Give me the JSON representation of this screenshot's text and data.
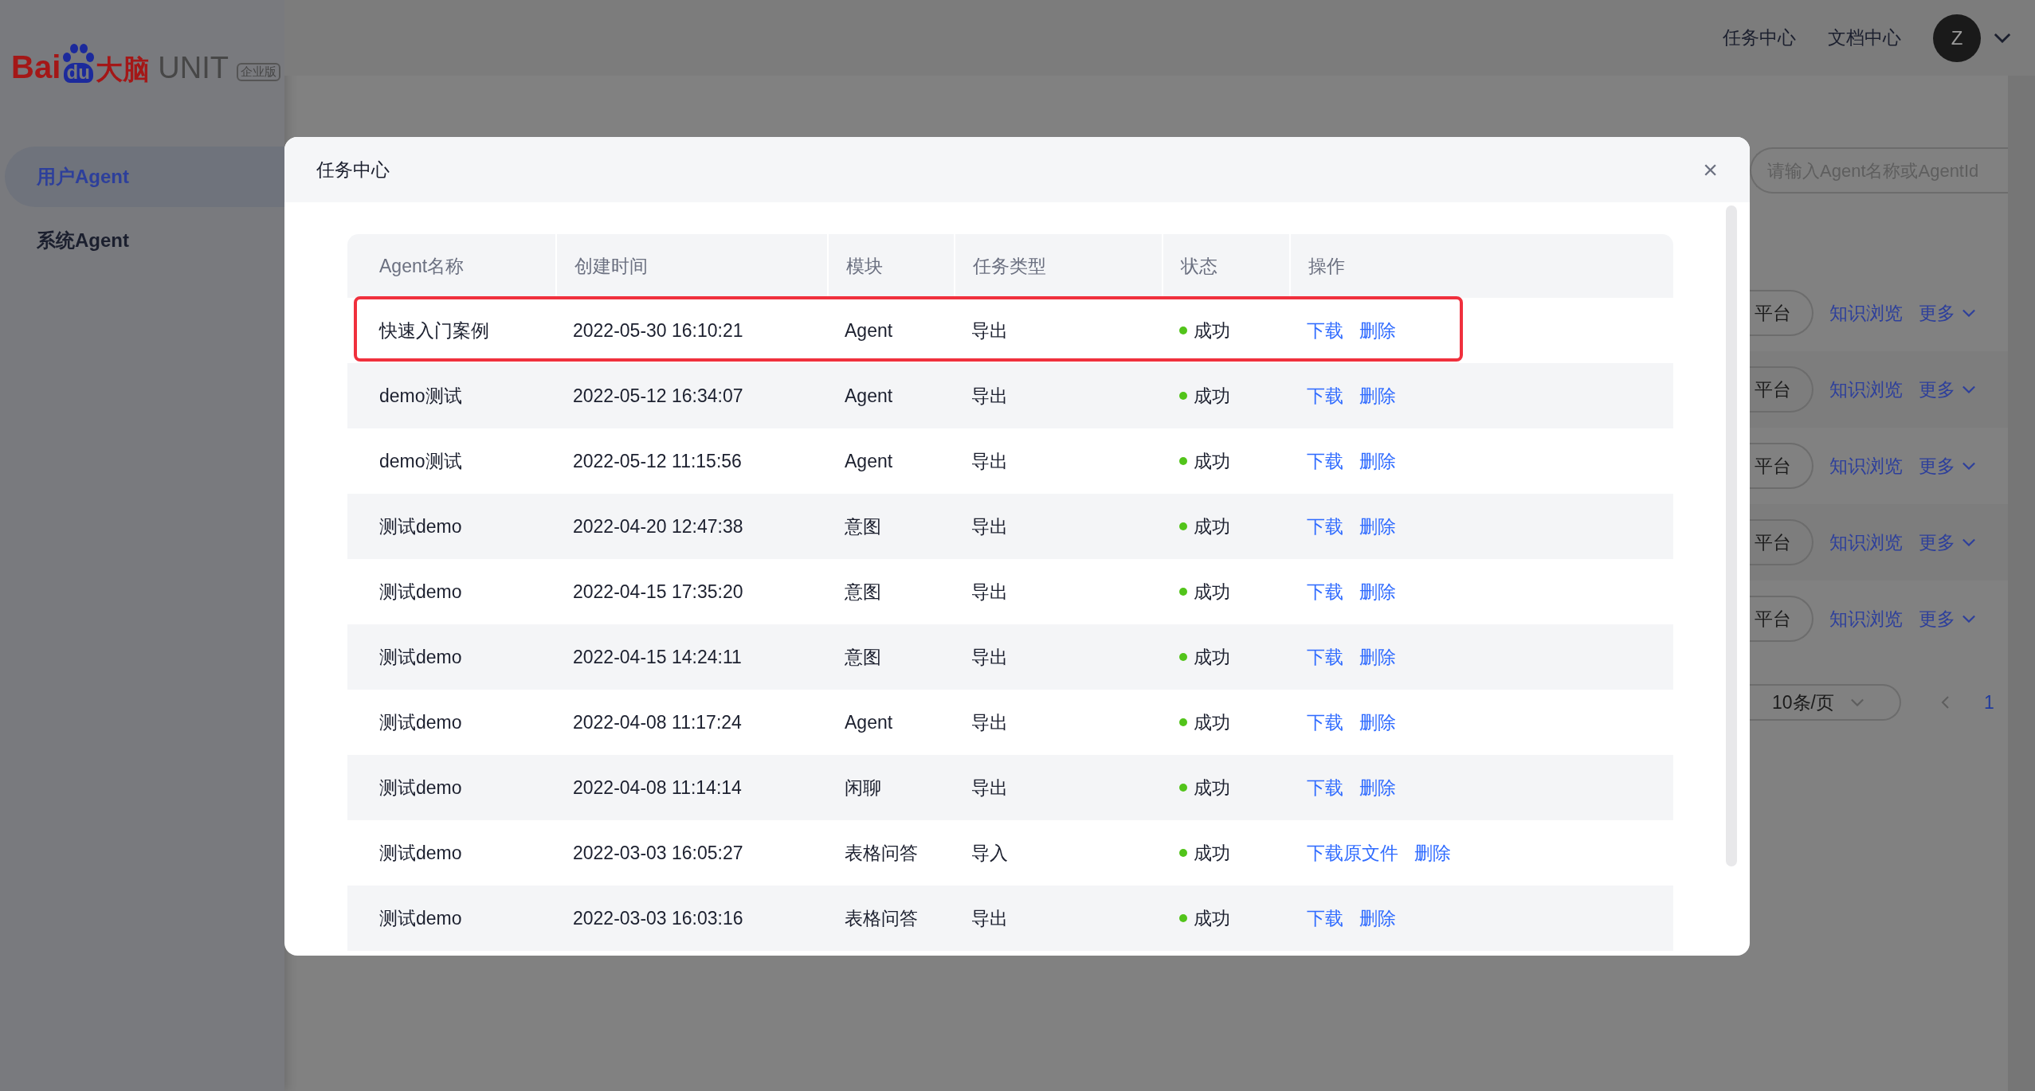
{
  "logo": {
    "prefix": "Bai",
    "paw_text": "du",
    "suffix": "大脑",
    "product": "UNIT",
    "edition": "企业版"
  },
  "sidebar": {
    "items": [
      {
        "label": "用户Agent",
        "selected": true
      },
      {
        "label": "系统Agent",
        "selected": false
      }
    ]
  },
  "header": {
    "links": [
      "任务中心",
      "文档中心"
    ],
    "avatar": "Z"
  },
  "background": {
    "search": {
      "placeholder": "请输入Agent名称或AgentId"
    },
    "rows": [
      {
        "tag": "平台",
        "link": "知识浏览",
        "more": "更多"
      },
      {
        "tag": "平台",
        "link": "知识浏览",
        "more": "更多"
      },
      {
        "tag": "平台",
        "link": "知识浏览",
        "more": "更多"
      },
      {
        "tag": "平台",
        "link": "知识浏览",
        "more": "更多"
      },
      {
        "tag": "平台",
        "link": "知识浏览",
        "more": "更多"
      }
    ],
    "pagination": {
      "page_size": "10条/页",
      "page": "1"
    }
  },
  "modal": {
    "title": "任务中心",
    "close": "×",
    "columns": [
      "Agent名称",
      "创建时间",
      "模块",
      "任务类型",
      "状态",
      "操作"
    ],
    "rows": [
      {
        "name": "快速入门案例",
        "created": "2022-05-30 16:10:21",
        "module": "Agent",
        "type": "导出",
        "status": "成功",
        "actions": [
          "下载",
          "删除"
        ],
        "highlighted": true
      },
      {
        "name": "demo测试",
        "created": "2022-05-12 16:34:07",
        "module": "Agent",
        "type": "导出",
        "status": "成功",
        "actions": [
          "下载",
          "删除"
        ],
        "highlighted": false
      },
      {
        "name": "demo测试",
        "created": "2022-05-12 11:15:56",
        "module": "Agent",
        "type": "导出",
        "status": "成功",
        "actions": [
          "下载",
          "删除"
        ],
        "highlighted": false
      },
      {
        "name": "测试demo",
        "created": "2022-04-20 12:47:38",
        "module": "意图",
        "type": "导出",
        "status": "成功",
        "actions": [
          "下载",
          "删除"
        ],
        "highlighted": false
      },
      {
        "name": "测试demo",
        "created": "2022-04-15 17:35:20",
        "module": "意图",
        "type": "导出",
        "status": "成功",
        "actions": [
          "下载",
          "删除"
        ],
        "highlighted": false
      },
      {
        "name": "测试demo",
        "created": "2022-04-15 14:24:11",
        "module": "意图",
        "type": "导出",
        "status": "成功",
        "actions": [
          "下载",
          "删除"
        ],
        "highlighted": false
      },
      {
        "name": "测试demo",
        "created": "2022-04-08 11:17:24",
        "module": "Agent",
        "type": "导出",
        "status": "成功",
        "actions": [
          "下载",
          "删除"
        ],
        "highlighted": false
      },
      {
        "name": "测试demo",
        "created": "2022-04-08 11:14:14",
        "module": "闲聊",
        "type": "导出",
        "status": "成功",
        "actions": [
          "下载",
          "删除"
        ],
        "highlighted": false
      },
      {
        "name": "测试demo",
        "created": "2022-03-03 16:05:27",
        "module": "表格问答",
        "type": "导入",
        "status": "成功",
        "actions": [
          "下载原文件",
          "删除"
        ],
        "highlighted": false
      },
      {
        "name": "测试demo",
        "created": "2022-03-03 16:03:16",
        "module": "表格问答",
        "type": "导出",
        "status": "成功",
        "actions": [
          "下载",
          "删除"
        ],
        "highlighted": false
      }
    ]
  }
}
